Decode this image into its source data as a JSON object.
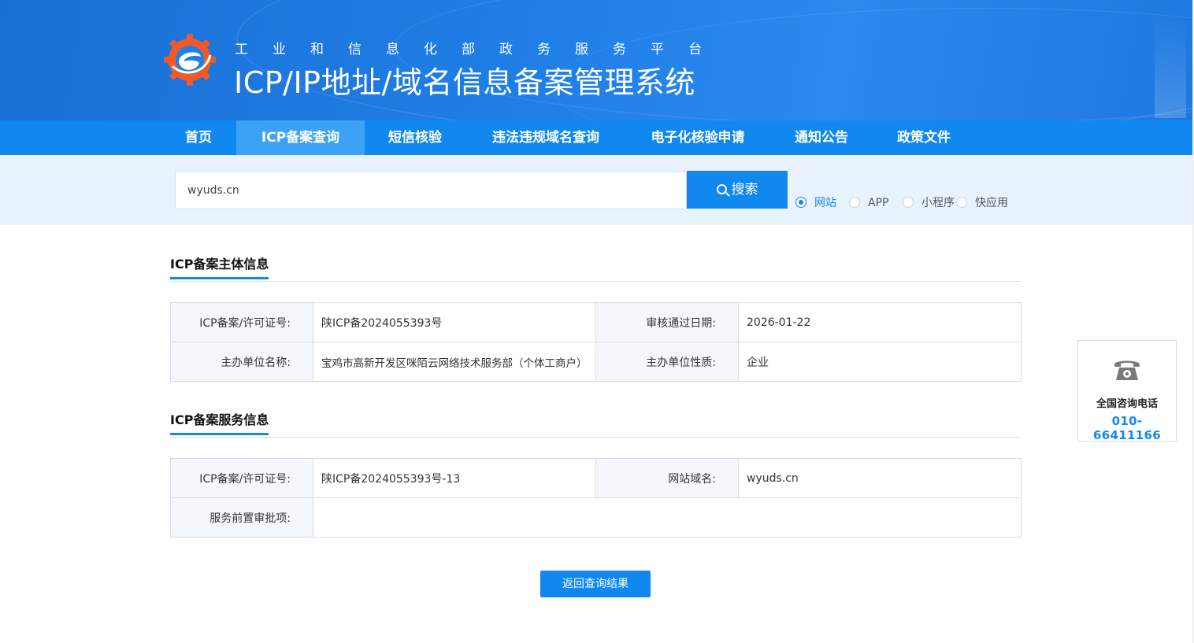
{
  "header": {
    "subtitle": "工业和信息化部政务服务平台",
    "title": "ICP/IP地址/域名信息备案管理系统"
  },
  "nav": {
    "items": [
      {
        "label": "首页"
      },
      {
        "label": "ICP备案查询"
      },
      {
        "label": "短信核验"
      },
      {
        "label": "违法违规域名查询"
      },
      {
        "label": "电子化核验申请"
      },
      {
        "label": "通知公告"
      },
      {
        "label": "政策文件"
      }
    ],
    "active": "ICP备案查询"
  },
  "search": {
    "value": "wyuds.cn",
    "button_label": "搜索",
    "types": [
      {
        "label": "网站",
        "checked": true
      },
      {
        "label": "APP",
        "checked": false
      },
      {
        "label": "小程序",
        "checked": false
      },
      {
        "label": "快应用",
        "checked": false
      }
    ]
  },
  "subject_section": {
    "title": "ICP备案主体信息",
    "rows": [
      {
        "k1": "ICP备案/许可证号:",
        "v1": "陕ICP备2024055393号",
        "k2": "审核通过日期:",
        "v2": "2026-01-22"
      },
      {
        "k1": "主办单位名称:",
        "v1": "宝鸡市高新开发区咪陌云网络技术服务部（个体工商户）",
        "k2": "主办单位性质:",
        "v2": "企业"
      }
    ]
  },
  "service_section": {
    "title": "ICP备案服务信息",
    "row1": {
      "k1": "ICP备案/许可证号:",
      "v1": "陕ICP备2024055393号-13",
      "k2": "网站域名:",
      "v2": "wyuds.cn"
    },
    "row2": {
      "k1": "服务前置审批项:",
      "v1": ""
    }
  },
  "back_button": {
    "label": "返回查询结果"
  },
  "contact": {
    "icon": "phone-icon",
    "label": "全国咨询电话",
    "number": "010-66411166"
  },
  "colors": {
    "primary": "#1188f0",
    "nav_active": "#3ba2f5",
    "logo_orange": "#f05a28"
  }
}
